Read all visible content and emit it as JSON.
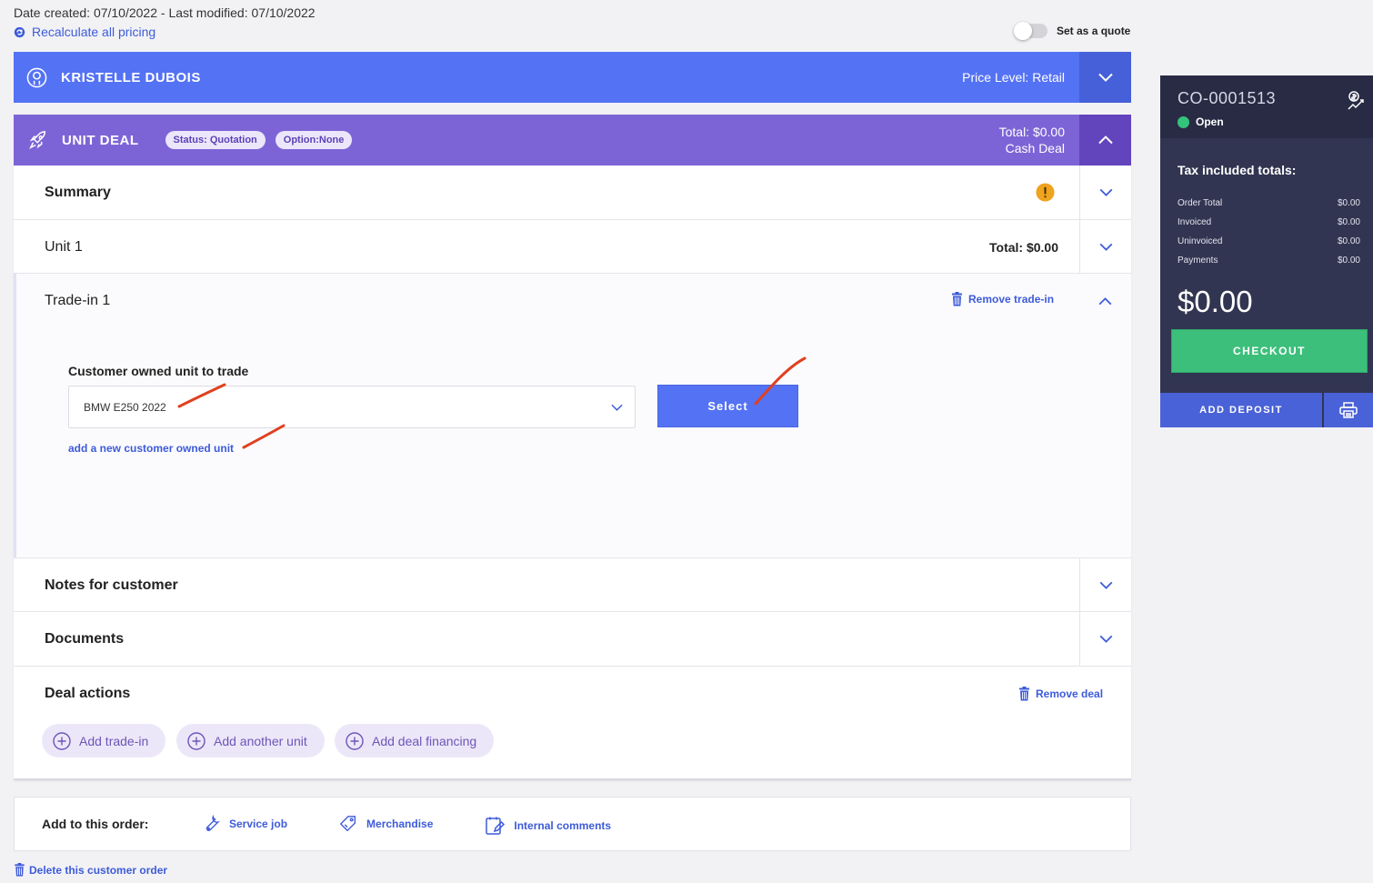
{
  "meta": {
    "dates": "Date created: 07/10/2022 - Last modified: 07/10/2022",
    "recalculate_label": "Recalculate all pricing",
    "quote_toggle_label": "Set as a quote"
  },
  "customer": {
    "name": "KRISTELLE DUBOIS",
    "price_level": "Price Level: Retail"
  },
  "deal": {
    "title": "UNIT DEAL",
    "status_pill": "Status: Quotation",
    "option_pill": "Option:None",
    "total": "Total: $0.00",
    "deal_type": "Cash Deal"
  },
  "sections": {
    "summary": "Summary",
    "unit": "Unit 1",
    "unit_total": "Total: $0.00",
    "tradein": "Trade-in 1",
    "remove_tradein": "Remove trade-in",
    "notes": "Notes for customer",
    "documents": "Documents",
    "deal_actions": "Deal actions",
    "remove_deal": "Remove deal"
  },
  "tradein": {
    "field_label": "Customer owned unit to trade",
    "selected_value": "BMW E250 2022",
    "select_button": "Select",
    "add_new_link": "add a new customer owned unit"
  },
  "actions": {
    "add_tradein": "Add trade-in",
    "add_unit": "Add another unit",
    "add_financing": "Add deal financing"
  },
  "add_to_order": {
    "label": "Add to this order:",
    "service_job": "Service job",
    "merchandise": "Merchandise",
    "internal_comments": "Internal comments"
  },
  "delete_order": "Delete this customer order",
  "sidebar": {
    "order_number": "CO-0001513",
    "status": "Open",
    "tax_heading": "Tax included totals:",
    "totals": [
      {
        "label": "Order Total",
        "value": "$0.00"
      },
      {
        "label": "Invoiced",
        "value": "$0.00"
      },
      {
        "label": "Uninvoiced",
        "value": "$0.00"
      },
      {
        "label": "Payments",
        "value": "$0.00"
      }
    ],
    "balance": "$0.00",
    "checkout": "CHECKOUT",
    "add_deposit": "ADD DEPOSIT"
  },
  "colors": {
    "customer_bar": "#5472f4",
    "deal_bar": "#7d64d6",
    "link": "#3d5bd9",
    "checkout": "#3cbf7b",
    "status_open": "#32c47a",
    "warning": "#f0a31e",
    "annotation": "#e0401f"
  }
}
